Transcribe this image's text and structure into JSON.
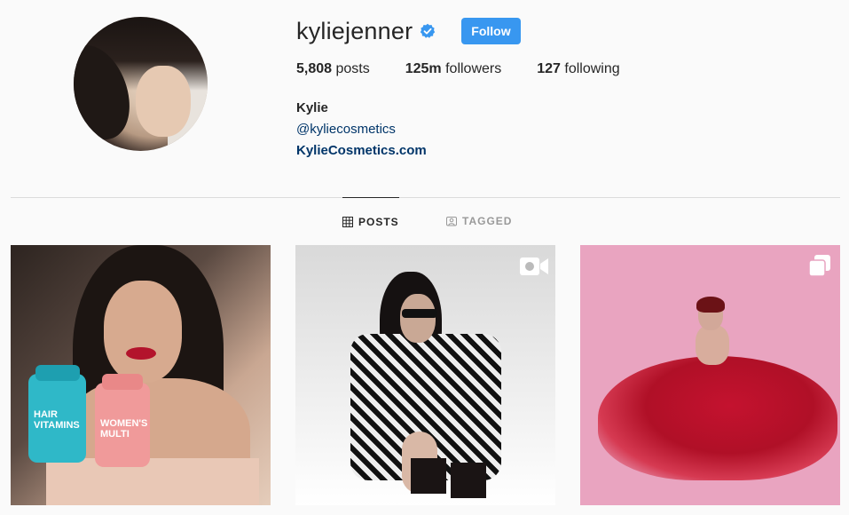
{
  "profile": {
    "username": "kyliejenner",
    "follow_label": "Follow",
    "stats": {
      "posts_count": "5,808",
      "posts_label": " posts",
      "followers_count": "125m",
      "followers_label": " followers",
      "following_count": "127",
      "following_label": " following"
    },
    "bio": {
      "name": "Kylie",
      "mention": "@kyliecosmetics",
      "link": "KylieCosmetics.com"
    }
  },
  "tabs": [
    {
      "label": "POSTS",
      "icon": "grid-icon",
      "active": true
    },
    {
      "label": "TAGGED",
      "icon": "tagged-icon",
      "active": false
    }
  ],
  "posts": [
    {
      "type": "photo",
      "product_labels": [
        "HAIR VITAMINS",
        "WOMEN'S MULTI"
      ]
    },
    {
      "type": "video",
      "overlay_icon": "video-camera-icon"
    },
    {
      "type": "carousel",
      "overlay_icon": "multiple-photos-icon"
    }
  ],
  "colors": {
    "accent": "#3897f0",
    "verified": "#3897f0",
    "link": "#003569",
    "text": "#262626",
    "muted": "#999999"
  }
}
